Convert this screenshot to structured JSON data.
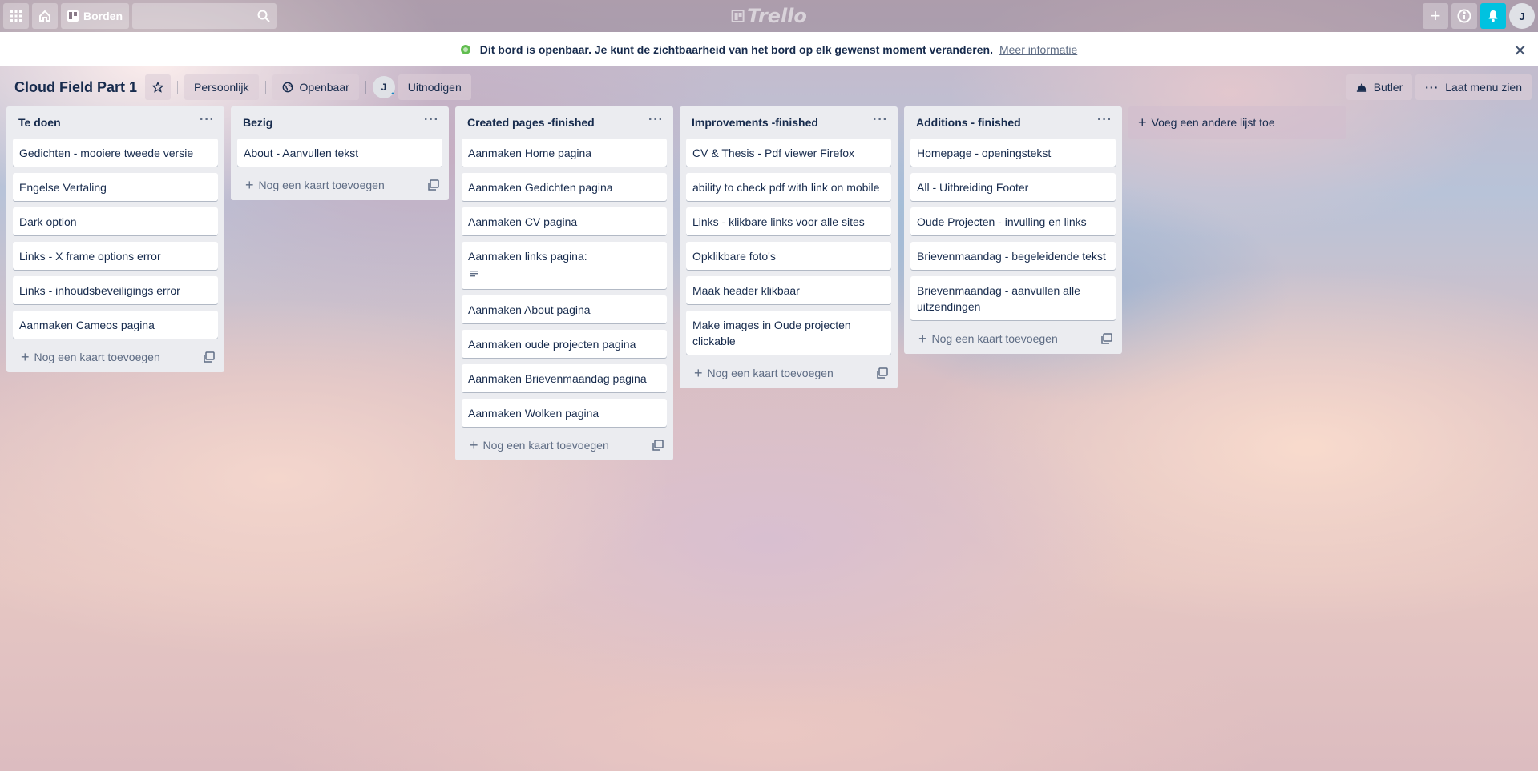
{
  "topbar": {
    "boards_label": "Borden",
    "search_placeholder": "",
    "logo_text": "Trello",
    "avatar_initial": "J"
  },
  "banner": {
    "message": "Dit bord is openbaar. Je kunt de zichtbaarheid van het bord op elk gewenst moment veranderen.",
    "link": "Meer informatie"
  },
  "board": {
    "title": "Cloud Field Part 1",
    "team_label": "Persoonlijk",
    "visibility_label": "Openbaar",
    "member_initial": "J",
    "invite_label": "Uitnodigen",
    "butler_label": "Butler",
    "menu_label": "Laat menu zien"
  },
  "add_card_label": "Nog een kaart toevoegen",
  "add_list_label": "Voeg een andere lijst toe",
  "lists": [
    {
      "title": "Te doen",
      "cards": [
        {
          "text": "Gedichten - mooiere tweede versie"
        },
        {
          "text": "Engelse Vertaling"
        },
        {
          "text": "Dark option"
        },
        {
          "text": "Links - X frame options error"
        },
        {
          "text": "Links - inhoudsbeveiligings error"
        },
        {
          "text": "Aanmaken Cameos pagina"
        }
      ]
    },
    {
      "title": "Bezig",
      "cards": [
        {
          "text": "About - Aanvullen tekst"
        }
      ]
    },
    {
      "title": "Created pages -finished",
      "cards": [
        {
          "text": "Aanmaken Home pagina"
        },
        {
          "text": "Aanmaken Gedichten pagina"
        },
        {
          "text": "Aanmaken CV pagina"
        },
        {
          "text": "Aanmaken links pagina:",
          "has_description": true
        },
        {
          "text": "Aanmaken About pagina"
        },
        {
          "text": "Aanmaken oude projecten pagina"
        },
        {
          "text": "Aanmaken Brievenmaandag pagina"
        },
        {
          "text": "Aanmaken Wolken pagina"
        }
      ]
    },
    {
      "title": "Improvements -finished",
      "cards": [
        {
          "text": "CV & Thesis - Pdf viewer Firefox"
        },
        {
          "text": "ability to check pdf with link on mobile"
        },
        {
          "text": "Links - klikbare links voor alle sites"
        },
        {
          "text": "Opklikbare foto's"
        },
        {
          "text": "Maak header klikbaar"
        },
        {
          "text": "Make images in Oude projecten clickable"
        }
      ]
    },
    {
      "title": "Additions - finished",
      "cards": [
        {
          "text": "Homepage - openingstekst"
        },
        {
          "text": "All - Uitbreiding Footer"
        },
        {
          "text": "Oude Projecten - invulling en links"
        },
        {
          "text": "Brievenmaandag - begeleidende tekst"
        },
        {
          "text": "Brievenmaandag - aanvullen alle uitzendingen"
        }
      ]
    }
  ]
}
